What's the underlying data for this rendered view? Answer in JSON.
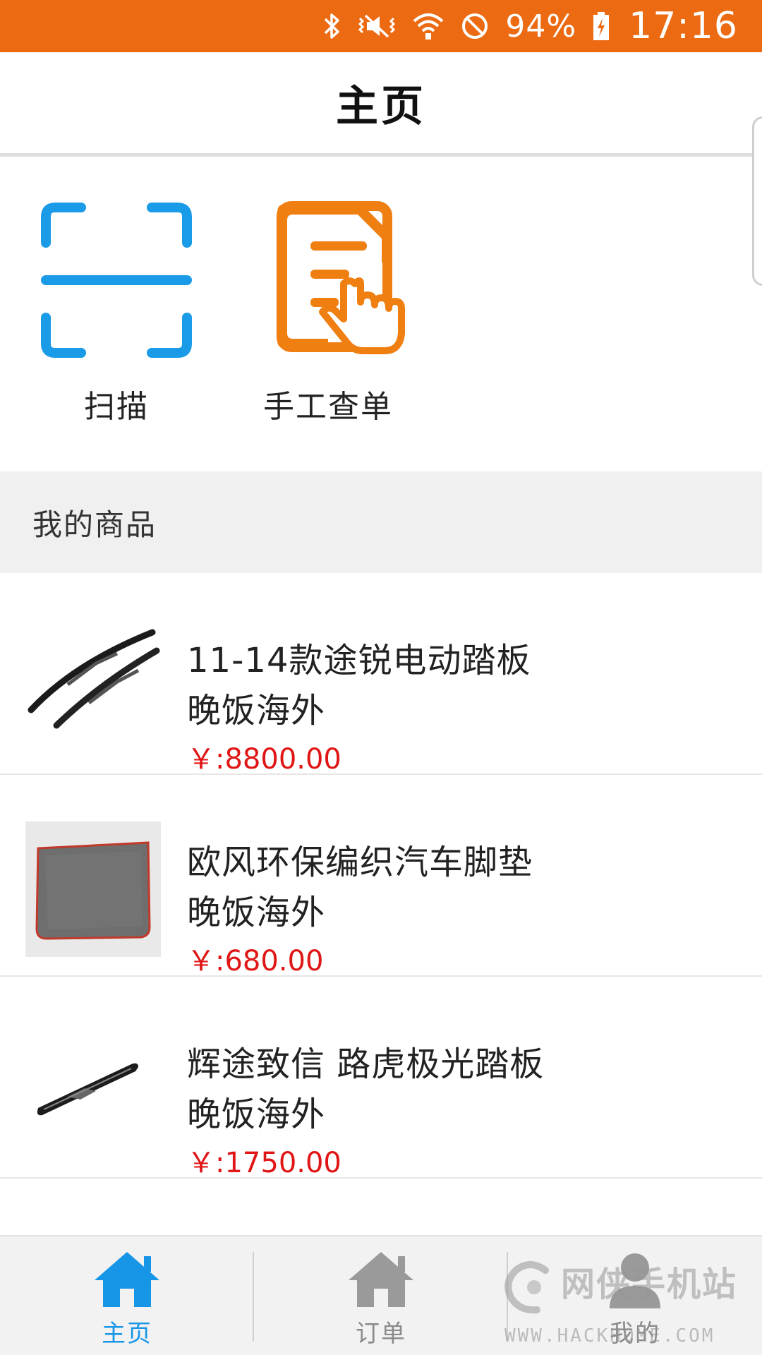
{
  "status_bar": {
    "battery_percent": "94%",
    "time": "17:16",
    "icons": [
      "bluetooth-icon",
      "vibrate-icon",
      "wifi-icon",
      "do-not-disturb-icon",
      "battery-charging-icon"
    ],
    "background": "#ec6a12"
  },
  "header": {
    "title": "主页"
  },
  "actions": [
    {
      "label": "扫描",
      "icon": "scan-icon",
      "color": "#1a9be8"
    },
    {
      "label": "手工查单",
      "icon": "manual-query-icon",
      "color": "#f07f12"
    }
  ],
  "section": {
    "title": "我的商品"
  },
  "products": [
    {
      "name": "11-14款途锐电动踏板",
      "seller": "晚饭海外",
      "price": "￥:8800.00",
      "image": "wiper-blades-image"
    },
    {
      "name": "欧风环保编织汽车脚垫",
      "seller": "晚饭海外",
      "price": "￥:680.00",
      "image": "car-mat-image"
    },
    {
      "name": "辉途致信 路虎极光踏板",
      "seller": "晚饭海外",
      "price": "￥:1750.00",
      "image": "running-board-image"
    }
  ],
  "bottom_nav": {
    "items": [
      {
        "label": "主页",
        "icon": "home-icon",
        "active": true
      },
      {
        "label": "订单",
        "icon": "home-icon",
        "active": false
      },
      {
        "label": "我的",
        "icon": "user-icon",
        "active": false
      }
    ],
    "active_color": "#1796e8",
    "inactive_color": "#8a8a8a"
  },
  "watermark": {
    "main": "网侠手机站",
    "sub": "WWW.HACKHOME.COM"
  },
  "colors": {
    "price": "#e01515",
    "section_bg": "#f0f0f0"
  }
}
